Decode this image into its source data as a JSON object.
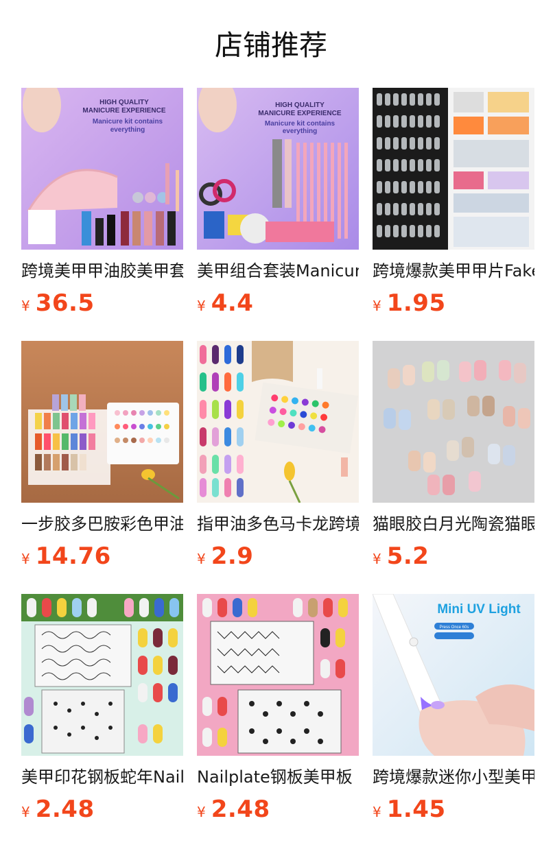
{
  "section": {
    "title": "店铺推荐"
  },
  "currency_symbol": "¥",
  "products": [
    {
      "name": "跨境美甲甲油胶美甲套装",
      "price": "36.5",
      "image": "manicure-kit-lamp",
      "image_text": [
        "HIGH QUALITY",
        "MANICURE EXPERIENCE",
        "Manicure kit contains",
        "everything"
      ]
    },
    {
      "name": "美甲组合套装Manicure",
      "price": "4.4",
      "image": "manicure-kit-brushes",
      "image_text": [
        "HIGH QUALITY",
        "MANICURE EXPERIENCE",
        "Manicure kit contains",
        "everything"
      ]
    },
    {
      "name": "跨境爆款美甲甲片Fake",
      "price": "1.95",
      "image": "clear-nail-tips"
    },
    {
      "name": "一步胶多巴胺彩色甲油胶",
      "price": "14.76",
      "image": "gel-polish-display"
    },
    {
      "name": "指甲油多色马卡龙跨境",
      "price": "2.9",
      "image": "nail-polish-color-box"
    },
    {
      "name": "猫眼胶白月光陶瓷猫眼",
      "price": "5.2",
      "image": "cat-eye-swatches"
    },
    {
      "name": "美甲印花钢板蛇年Nail",
      "price": "2.48",
      "image": "stamping-plates-green"
    },
    {
      "name": "Nailplate钢板美甲板",
      "price": "2.48",
      "image": "stamping-plates-pink"
    },
    {
      "name": "跨境爆款迷你小型美甲灯",
      "price": "1.45",
      "image": "mini-uv-light",
      "image_text": [
        "Mini UV Light",
        "Press Once 60s"
      ]
    }
  ],
  "colors": {
    "price": "#f2461b",
    "title": "#111111"
  }
}
